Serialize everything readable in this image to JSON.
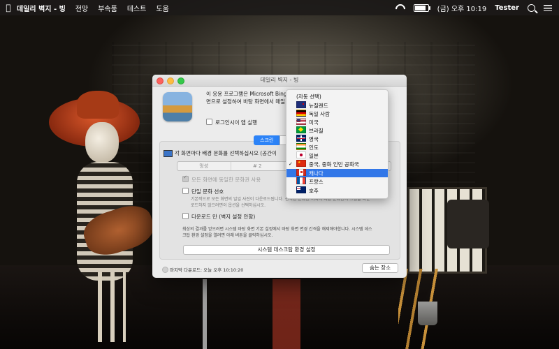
{
  "menubar": {
    "app_name": "데일리 벽지 - 빙",
    "items": [
      "전망",
      "부속품",
      "테스트",
      "도움"
    ],
    "clock": "(금) 오후 10:19",
    "user": "Tester"
  },
  "window": {
    "title": "데일리 벽지 - 빙",
    "intro_line1": "이 응용 프로그램은 Microsoft Bing 화",
    "intro_line2": "면으로 설정하여 바탕 화면에서 매일",
    "login_label": "로그인시이 앱 실행",
    "tabs": [
      "스크린",
      "온닉"
    ],
    "monitor_label": "각 화면마다 배경 문화를 선택하십시오 (공간이",
    "monitor_tabs": [
      "멍성",
      "# 2",
      "# 상",
      "# 4"
    ],
    "opt_same": "모든 화면에 동일한 문화권 사용",
    "opt_single": "단일 문화 선호",
    "opt_single_desc1": "기본적으로 모든 화면의 일일 사진이 다운로드됩니다. 선택한 문화권 이외의 다른 문화권의 그림을 다운",
    "opt_single_desc2": "로드하지 않으려면이 옵션을 선택하십시오.",
    "opt_download": "다운로드 만 (벽지 설정 안함)",
    "info1": "최상의 결과를 얻으려면 시스템 바탕 화면 기본 설정에서 바탕 화면 변경 간격을 해제해야합니다. 시스템 데스",
    "info2": "크탑 환경 설정을 열려면 아래 버튼을 클릭하십시오.",
    "system_button": "시스템 데스크탑 환경 설정",
    "last_download": "마지막 다운로드: 오늘 오후 10:10:20",
    "hide_button": "숨는 장소"
  },
  "dropdown": {
    "items": [
      {
        "label": "(자동 선택)",
        "flag": ""
      },
      {
        "label": "뉴질랜드",
        "flag": "nz"
      },
      {
        "label": "독일 사람",
        "flag": "de"
      },
      {
        "label": "미국",
        "flag": "us"
      },
      {
        "label": "브라질",
        "flag": "br"
      },
      {
        "label": "영국",
        "flag": "gb"
      },
      {
        "label": "인도",
        "flag": "in"
      },
      {
        "label": "일본",
        "flag": "jp"
      },
      {
        "label": "중국, 중화 인민 공화국",
        "flag": "cn",
        "checked": true
      },
      {
        "label": "캐나다",
        "flag": "ca",
        "highlighted": true
      },
      {
        "label": "프랑스",
        "flag": "fr"
      },
      {
        "label": "호주",
        "flag": "au"
      }
    ]
  },
  "colors": {
    "accent": "#3277e8",
    "close": "#fc615d",
    "minimize": "#fdbc40",
    "maximize": "#34c84a"
  }
}
